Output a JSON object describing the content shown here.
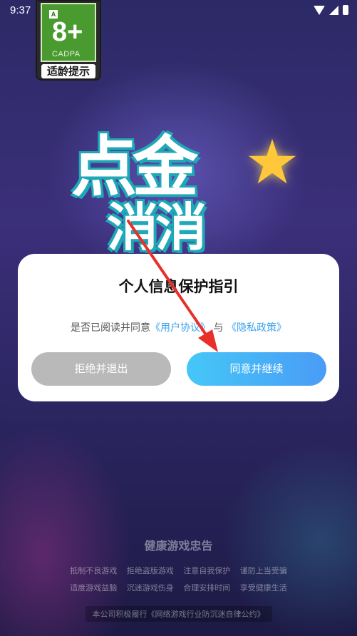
{
  "status_bar": {
    "time": "9:37"
  },
  "age_rating": {
    "corner_letter": "A",
    "age": "8+",
    "org": "CADPA",
    "label": "适龄提示"
  },
  "logo": {
    "line1": "点金",
    "line2": "消消"
  },
  "dialog": {
    "title": "个人信息保护指引",
    "body_prefix": "是否已阅读并同意",
    "user_agreement_link": "《用户协议》",
    "body_joiner": "与",
    "privacy_policy_link": "《隐私政策》",
    "refuse_button": "拒绝并退出",
    "agree_button": "同意并继续"
  },
  "health_notice": {
    "title": "健康游戏忠告",
    "line1": "抵制不良游戏 拒绝盗版游戏 注意自我保护 谨防上当受骗",
    "line2": "适度游戏益脑 沉迷游戏伤身 合理安排时间 享受健康生活",
    "pact": "本公司积极履行《网络游戏行业防沉迷自律公约》"
  },
  "colors": {
    "accent_blue": "#45c7f7",
    "link_blue": "#3ba3f0",
    "refuse_gray": "#b9b9b9",
    "arrow_red": "#e8302a"
  }
}
